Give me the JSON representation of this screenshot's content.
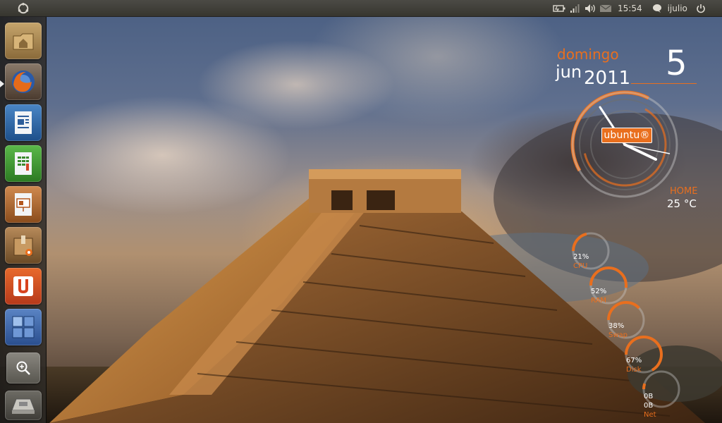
{
  "top_panel": {
    "clock": "15:54",
    "user": "ijulio",
    "icons": [
      "ubuntu-logo-icon",
      "battery-icon",
      "network-signal-icon",
      "volume-icon",
      "mail-icon",
      "chat-icon",
      "power-icon"
    ]
  },
  "launcher": {
    "items": [
      {
        "name": "home-folder",
        "icon": "folder-icon"
      },
      {
        "name": "firefox",
        "icon": "firefox-icon"
      },
      {
        "name": "writer",
        "icon": "writer-icon"
      },
      {
        "name": "calc",
        "icon": "spreadsheet-icon"
      },
      {
        "name": "impress",
        "icon": "presentation-icon"
      },
      {
        "name": "software-center",
        "icon": "box-icon"
      },
      {
        "name": "ubuntu-one",
        "icon": "ubuntu-one-icon"
      },
      {
        "name": "workspaces",
        "icon": "workspaces-icon"
      },
      {
        "name": "dash-search",
        "icon": "search-icon"
      },
      {
        "name": "trash",
        "icon": "trash-icon"
      }
    ]
  },
  "conky": {
    "day_name": "domingo",
    "month": "jun",
    "year": "2011",
    "day": "5",
    "clock_badge": "ubuntu®",
    "weather": {
      "location": "HOME",
      "temp": "25 °C"
    },
    "meters": [
      {
        "value": "21%",
        "label": "CPU",
        "fraction": 0.21
      },
      {
        "value": "52%",
        "label": "RAM",
        "fraction": 0.52
      },
      {
        "value": "38%",
        "label": "Swap",
        "fraction": 0.38
      },
      {
        "value": "67%",
        "label": "Disk",
        "fraction": 0.67
      },
      {
        "value": "0B",
        "value2": "0B",
        "label": "Net",
        "fraction": 0.05
      }
    ],
    "accent_color": "#e96f1e"
  }
}
